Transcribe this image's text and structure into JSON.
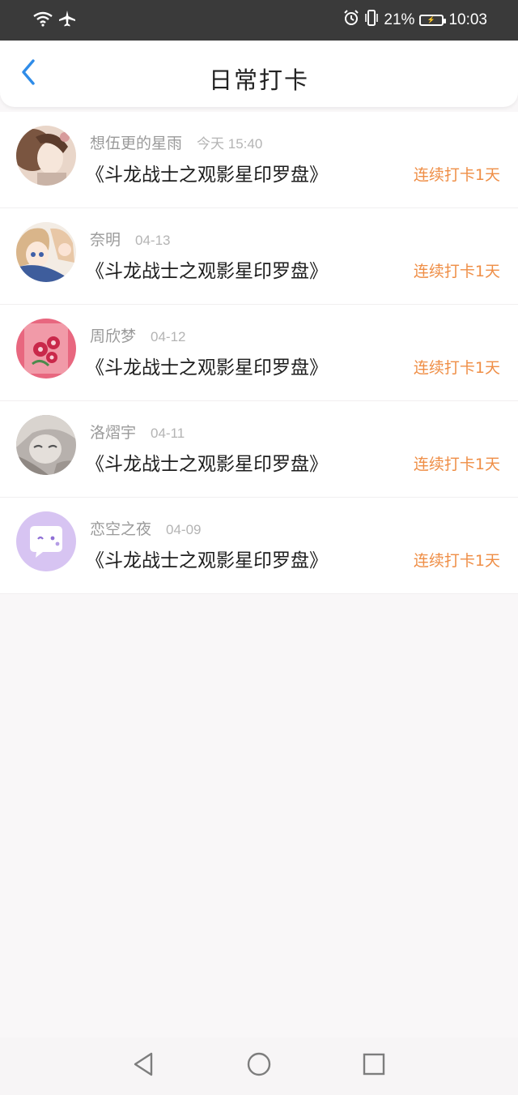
{
  "status_bar": {
    "battery_percent": "21%",
    "time": "10:03"
  },
  "header": {
    "title": "日常打卡",
    "back_icon": "chevron-left-icon",
    "accent_color": "#2f8ce8"
  },
  "checkins": [
    {
      "username": "想伍更的星雨",
      "date": "今天 15:40",
      "title": "《斗龙战士之观影星印罗盘》",
      "streak": "连续打卡1天"
    },
    {
      "username": "奈明",
      "date": "04-13",
      "title": "《斗龙战士之观影星印罗盘》",
      "streak": "连续打卡1天"
    },
    {
      "username": "周欣梦",
      "date": "04-12",
      "title": "《斗龙战士之观影星印罗盘》",
      "streak": "连续打卡1天"
    },
    {
      "username": "洛熠宇",
      "date": "04-11",
      "title": "《斗龙战士之观影星印罗盘》",
      "streak": "连续打卡1天"
    },
    {
      "username": "恋空之夜",
      "date": "04-09",
      "title": "《斗龙战士之观影星印罗盘》",
      "streak": "连续打卡1天"
    }
  ],
  "streak_color": "#ef8e46",
  "nav_bar": {
    "back_icon": "triangle-back-icon",
    "home_icon": "circle-home-icon",
    "recents_icon": "square-recents-icon"
  }
}
